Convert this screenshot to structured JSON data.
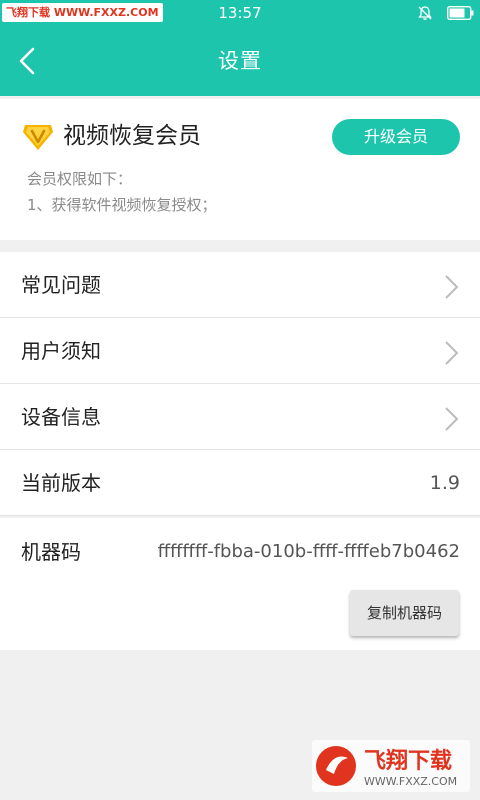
{
  "status": {
    "watermark": "飞翔下载 WWW.FXXZ.COM",
    "time": "13:57"
  },
  "header": {
    "title": "设置"
  },
  "member": {
    "title": "视频恢复会员",
    "upgrade_label": "升级会员",
    "perm_heading": "会员权限如下：",
    "perm_item": "1、获得软件视频恢复授权；"
  },
  "menu": [
    {
      "label": "常见问题"
    },
    {
      "label": "用户须知"
    },
    {
      "label": "设备信息"
    }
  ],
  "version": {
    "label": "当前版本",
    "value": "1.9"
  },
  "machine": {
    "label": "机器码",
    "value": "ffffffff-fbba-010b-ffff-ffffeb7b0462",
    "copy_label": "复制机器码"
  },
  "watermark_logo": {
    "brand": "飞翔下载",
    "url": "WWW.FXXZ.COM"
  },
  "colors": {
    "accent": "#1ec5ad",
    "vip_gold": "#f5b400",
    "watermark_red": "#e0341f"
  }
}
